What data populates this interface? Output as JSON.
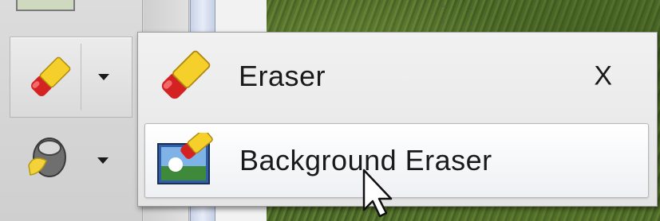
{
  "menu": {
    "items": [
      {
        "label": "Eraser",
        "shortcut": "X",
        "icon": "eraser-icon"
      },
      {
        "label": "Background Eraser",
        "shortcut": "",
        "icon": "background-eraser-icon",
        "highlighted": true
      }
    ]
  },
  "toolbar": {
    "tools": [
      {
        "icon": "eraser-icon",
        "has_dropdown": true
      },
      {
        "icon": "paint-bucket-icon",
        "has_dropdown": true
      }
    ]
  },
  "ruler_ticks": [
    "°",
    "-",
    "°",
    "-"
  ],
  "colors": {
    "menu_bg": "#e9e9e9",
    "highlight_bg": "#f7f8fa",
    "eraser_red": "#d42222",
    "eraser_yellow": "#f5cf2a"
  }
}
